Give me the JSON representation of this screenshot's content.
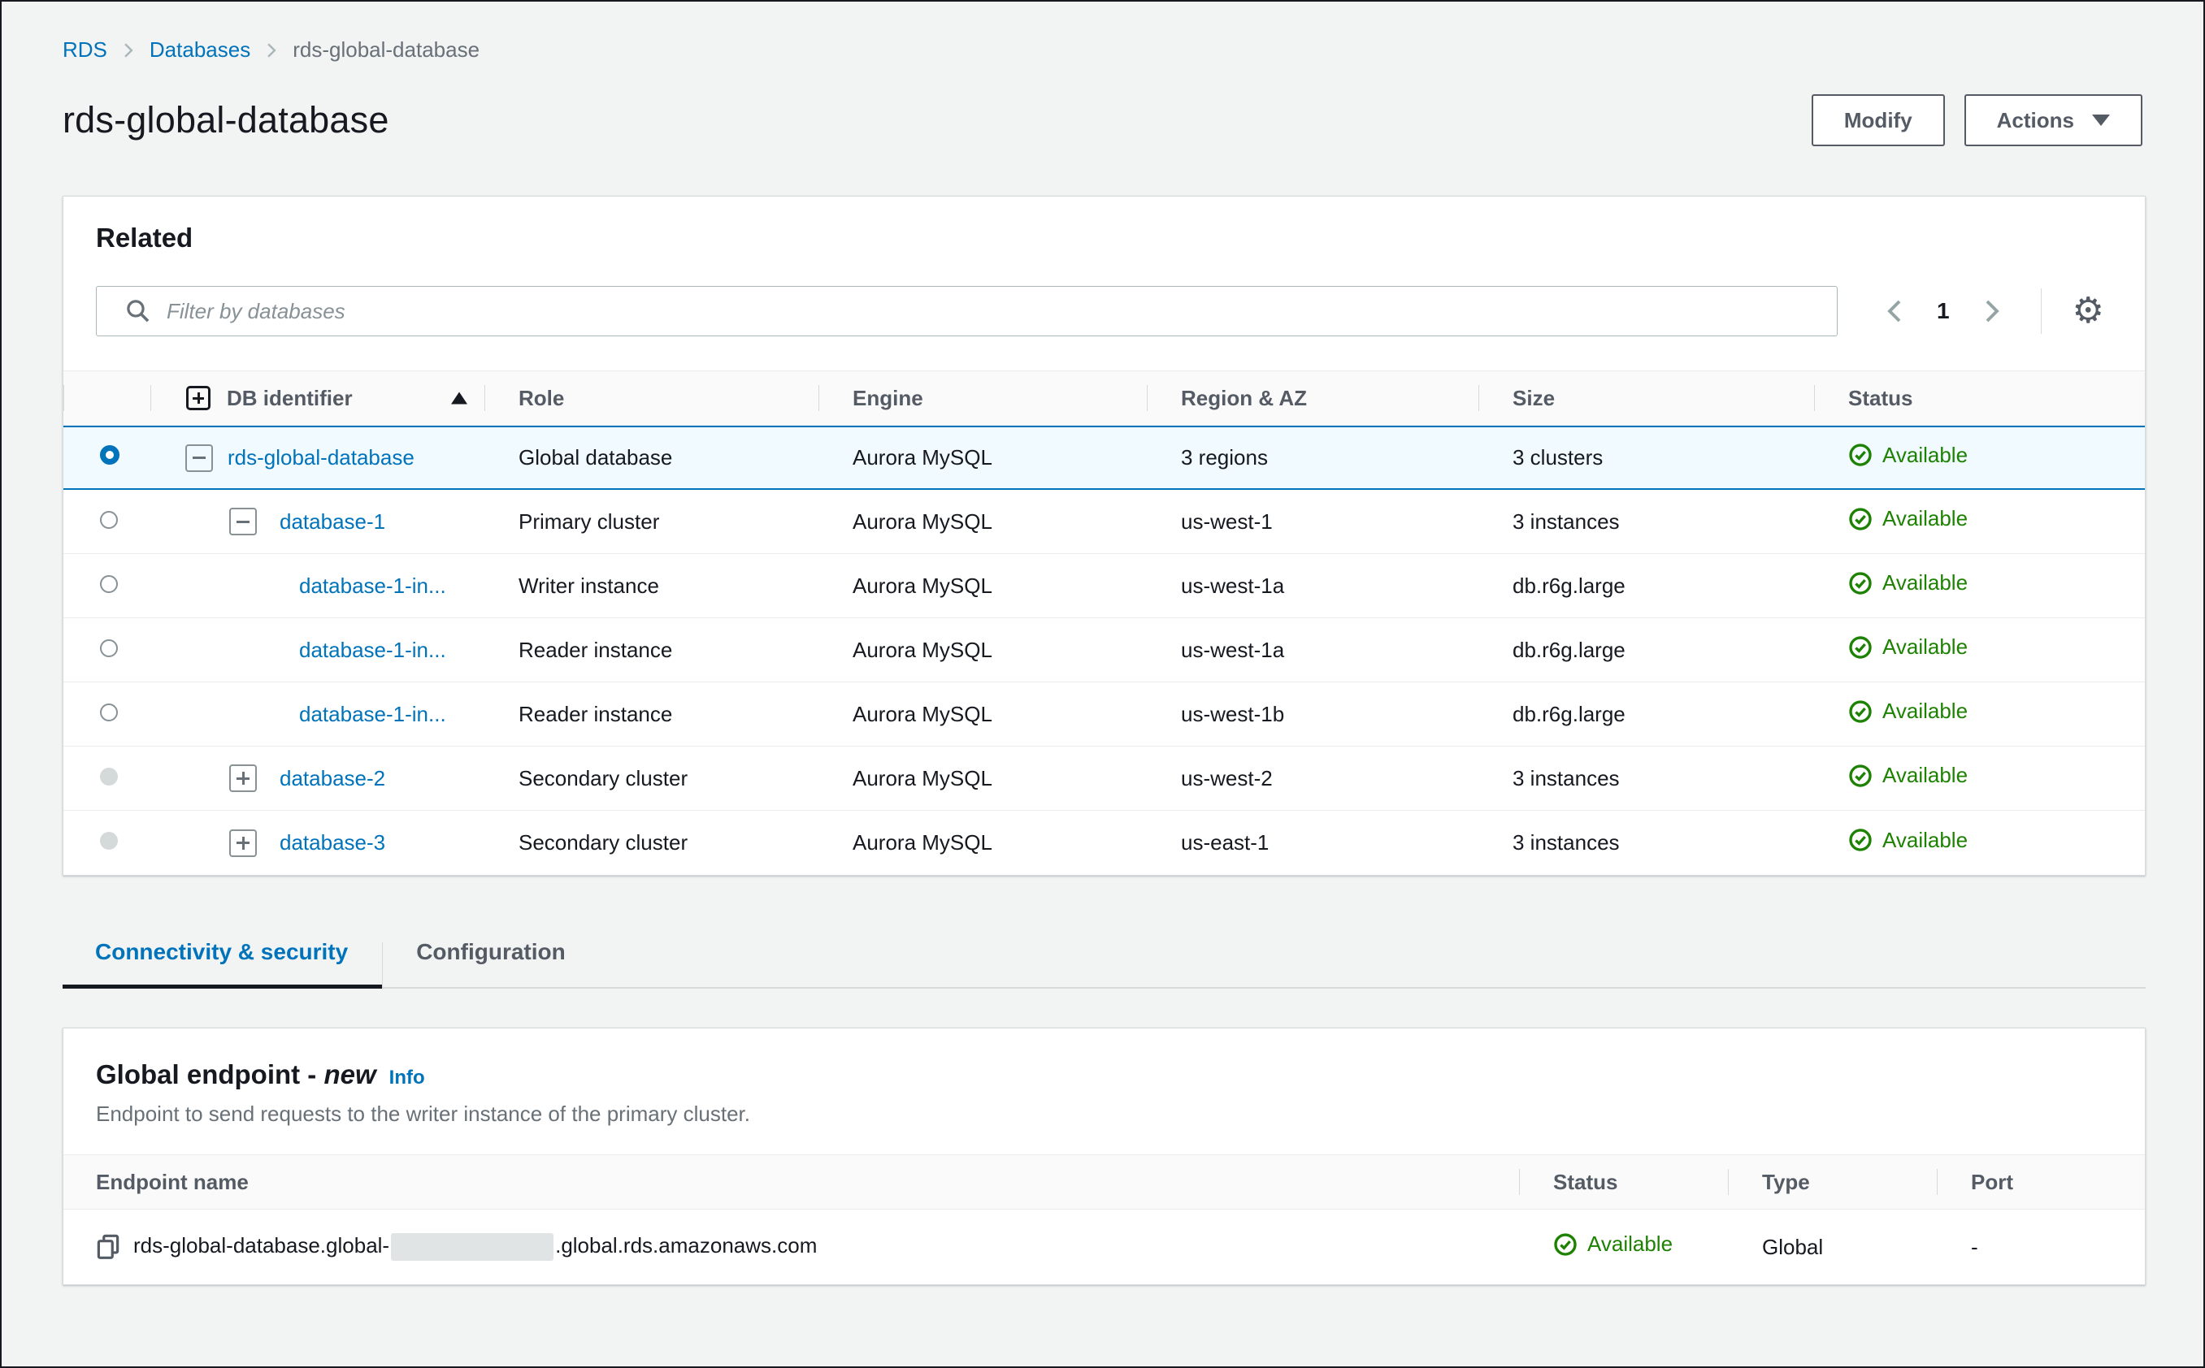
{
  "breadcrumb": {
    "items": [
      "RDS",
      "Databases",
      "rds-global-database"
    ]
  },
  "page": {
    "title": "rds-global-database"
  },
  "toolbar": {
    "modify_label": "Modify",
    "actions_label": "Actions"
  },
  "related": {
    "title": "Related",
    "filter_placeholder": "Filter by databases",
    "pagination": {
      "page": "1"
    },
    "table": {
      "columns": [
        "DB identifier",
        "Role",
        "Engine",
        "Region & AZ",
        "Size",
        "Status"
      ],
      "sort_column": "DB identifier",
      "sort_direction": "ascending",
      "rows": [
        {
          "id": "rds-global-database",
          "role": "Global database",
          "engine": "Aurora MySQL",
          "region_az": "3 regions",
          "size": "3 clusters",
          "status": "Available",
          "level": 0,
          "expand": "expanded",
          "radio": "checked",
          "selected": true
        },
        {
          "id": "database-1",
          "role": "Primary cluster",
          "engine": "Aurora MySQL",
          "region_az": "us-west-1",
          "size": "3 instances",
          "status": "Available",
          "level": 1,
          "expand": "expanded",
          "radio": "unchecked",
          "selected": false
        },
        {
          "id": "database-1-in...",
          "role": "Writer instance",
          "engine": "Aurora MySQL",
          "region_az": "us-west-1a",
          "size": "db.r6g.large",
          "status": "Available",
          "level": 2,
          "expand": null,
          "radio": "unchecked",
          "selected": false
        },
        {
          "id": "database-1-in...",
          "role": "Reader instance",
          "engine": "Aurora MySQL",
          "region_az": "us-west-1a",
          "size": "db.r6g.large",
          "status": "Available",
          "level": 2,
          "expand": null,
          "radio": "unchecked",
          "selected": false
        },
        {
          "id": "database-1-in...",
          "role": "Reader instance",
          "engine": "Aurora MySQL",
          "region_az": "us-west-1b",
          "size": "db.r6g.large",
          "status": "Available",
          "level": 2,
          "expand": null,
          "radio": "unchecked",
          "selected": false
        },
        {
          "id": "database-2",
          "role": "Secondary cluster",
          "engine": "Aurora MySQL",
          "region_az": "us-west-2",
          "size": "3 instances",
          "status": "Available",
          "level": 1,
          "expand": "collapsed",
          "radio": "disabled",
          "selected": false
        },
        {
          "id": "database-3",
          "role": "Secondary cluster",
          "engine": "Aurora MySQL",
          "region_az": "us-east-1",
          "size": "3 instances",
          "status": "Available",
          "level": 1,
          "expand": "collapsed",
          "radio": "disabled",
          "selected": false
        }
      ]
    }
  },
  "tabs": [
    {
      "label": "Connectivity & security",
      "active": true
    },
    {
      "label": "Configuration",
      "active": false
    }
  ],
  "global_endpoint": {
    "title": "Global endpoint -",
    "title_highlight": "new",
    "info_label": "Info",
    "description": "Endpoint to send requests to the writer instance of the primary cluster.",
    "table": {
      "columns": [
        "Endpoint name",
        "Status",
        "Type",
        "Port"
      ],
      "row": {
        "endpoint_prefix": "rds-global-database.global-",
        "endpoint_redacted": true,
        "endpoint_suffix": ".global.rds.amazonaws.com",
        "status": "Available",
        "type": "Global",
        "port": "-"
      }
    }
  },
  "colors": {
    "link_blue": "#0073bb",
    "selected_row_bg": "#f1faff",
    "selected_row_border": "#0073bb",
    "success_green": "#1d8102",
    "page_bg": "#f2f3f3"
  },
  "icons": {
    "gear": "⚙"
  }
}
